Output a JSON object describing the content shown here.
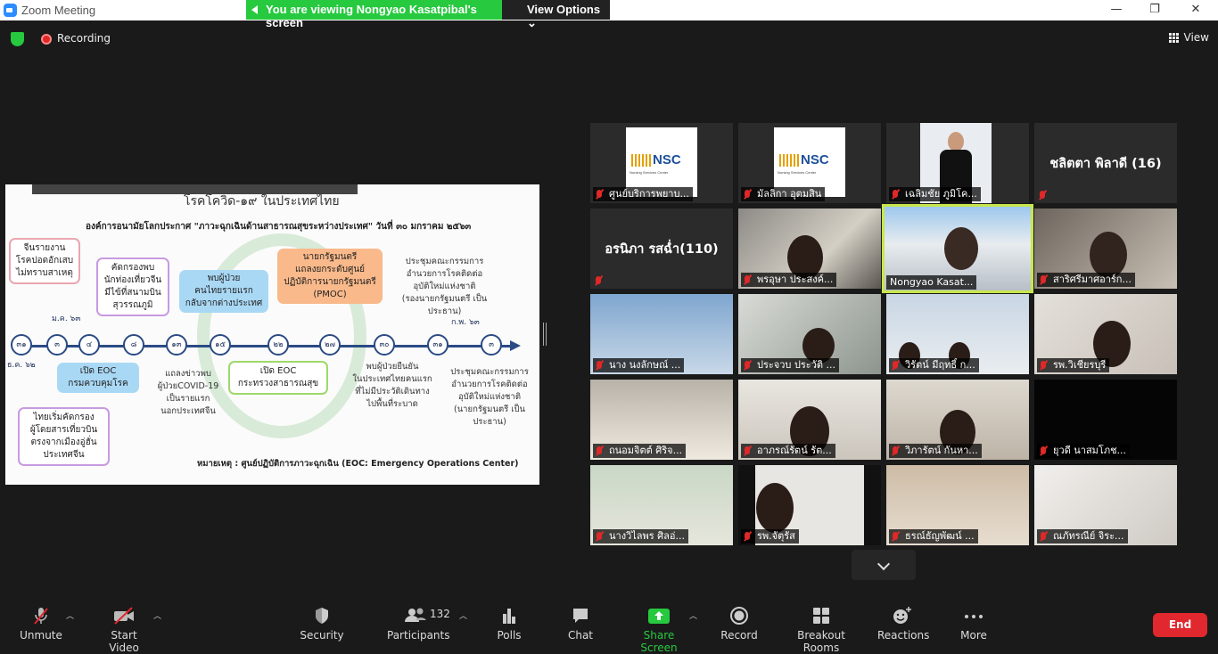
{
  "window": {
    "title": "Zoom Meeting",
    "minimize": "—",
    "restore": "❐",
    "close": "✕"
  },
  "share_banner": {
    "message": "You are viewing Nongyao Kasatpibal's screen",
    "view_options": "View Options ⌄"
  },
  "top": {
    "recording_label": "Recording",
    "view_label": "View"
  },
  "slide": {
    "header": "โรคโควิด-๑๙ ในประเทศไทย",
    "subheader": "องค์การอนามัยโลกประกาศ \"ภาวะฉุกเฉินด้านสาธารณสุขระหว่างประเทศ\" วันที่ ๓๐ มกราคม ๒๕๖๓",
    "boxes": {
      "b1": "จีนรายงาน\nโรคปอดอักเสบ\nไม่ทราบสาเหตุ",
      "b2": "คัดกรองพบ\nนักท่องเที่ยวจีน\nมีไข้ที่สนามบิน\nสุวรรณภูมิ",
      "b3": "พบผู้ป่วย\nคนไทยรายแรก\nกลับจากต่างประเทศ",
      "b4": "นายกรัฐมนตรี\nแถลงยกระดับศูนย์\nปฏิบัติการนายกรัฐมนตรี\n(PMOC)",
      "b5": "ประชุมคณะกรรมการ\nอำนวยการโรคติดต่อ\nอุบัติใหม่แห่งชาติ\n(รองนายกรัฐมนตรี เป็นประธาน)",
      "b6": "เปิด EOC\nกรมควบคุมโรค",
      "b7": "แถลงข่าวพบ\nผู้ป่วยCOVID-19\nเป็นรายแรก\nนอกประเทศจีน",
      "b8": "เปิด EOC\nกระทรวงสาธารณสุข",
      "b9": "พบผู้ป่วยยืนยัน\nในประเทศไทยคนแรก\nที่ไม่มีประวัติเดินทาง\nไปพื้นที่ระบาด",
      "b10": "ประชุมคณะกรรมการ\nอำนวยการโรคติดต่อ\nอุบัติใหม่แห่งชาติ\n(นายกรัฐมนตรี เป็นประธาน)",
      "b11": "ไทยเริ่มคัดกรอง\nผู้โดยสารเที่ยวบิน\nตรงจากเมืองอู่ฮั่น\nประเทศจีน"
    },
    "nodes": [
      "๓๑",
      "๓",
      "๔",
      "๘",
      "๑๓",
      "๑๕",
      "๒๒",
      "๒๗",
      "๓๐",
      "๓๑",
      "๓"
    ],
    "months": {
      "m1": "ธ.ค. ๖๒",
      "m2": "ม.ค. ๖๓",
      "m3": "ก.พ. ๖๓"
    },
    "footnote": "หมายเหตุ : ศูนย์ปฏิบัติการภาวะฉุกเฉิน (EOC: Emergency Operations Center)"
  },
  "participants": [
    {
      "name": "ศูนย์บริการพยาบ...",
      "kind": "logo"
    },
    {
      "name": "มัลลิกา  อุตมสิน",
      "kind": "logo"
    },
    {
      "name": "เฉลิมชัย ภูมิโค...",
      "kind": "person"
    },
    {
      "name": "",
      "big": "ชลิตตา  พิลาดี (16)",
      "kind": "text"
    },
    {
      "name": "",
      "big": "อรนิภา รสฉ่ำ(110)",
      "kind": "text"
    },
    {
      "name": "พรอุษา ประสงค์...",
      "kind": "video"
    },
    {
      "name": "Nongyao Kasat...",
      "kind": "active"
    },
    {
      "name": "สาริศรีมาศอาร์ก...",
      "kind": "video"
    },
    {
      "name": "นาง นงลักษณ์ ...",
      "kind": "video"
    },
    {
      "name": "ประจวบ ประวัติ ...",
      "kind": "video"
    },
    {
      "name": "วิรัตน์ มีฤทธิ์ ก...",
      "kind": "video"
    },
    {
      "name": "รพ.วิเชียรบุรี",
      "kind": "video"
    },
    {
      "name": "ถนอมจิตต์ ศิริจ...",
      "kind": "video"
    },
    {
      "name": "อาภรณ์รัตน์ รัต...",
      "kind": "video"
    },
    {
      "name": "วิภารัตน์ กันหา...",
      "kind": "video"
    },
    {
      "name": "ยุวดี  นาสมโภช...",
      "kind": "dark"
    },
    {
      "name": "นางวิไลพร ศิลอ่...",
      "kind": "video"
    },
    {
      "name": "รพ.จัตุรัส",
      "kind": "video"
    },
    {
      "name": "ธรณ์ธัญพัฒน์ ...",
      "kind": "video"
    },
    {
      "name": "ณภัทรณีย์ จิระ...",
      "kind": "video"
    }
  ],
  "toolbar": {
    "unmute": "Unmute",
    "start_video": "Start Video",
    "security": "Security",
    "participants": "Participants",
    "participants_count": "132",
    "polls": "Polls",
    "chat": "Chat",
    "share_screen": "Share Screen",
    "record": "Record",
    "breakout_rooms": "Breakout Rooms",
    "reactions": "Reactions",
    "more": "More",
    "end": "End"
  },
  "colors": {
    "accent_green": "#27c93f",
    "end_red": "#e0282e",
    "active_speaker": "#c8e64c"
  }
}
